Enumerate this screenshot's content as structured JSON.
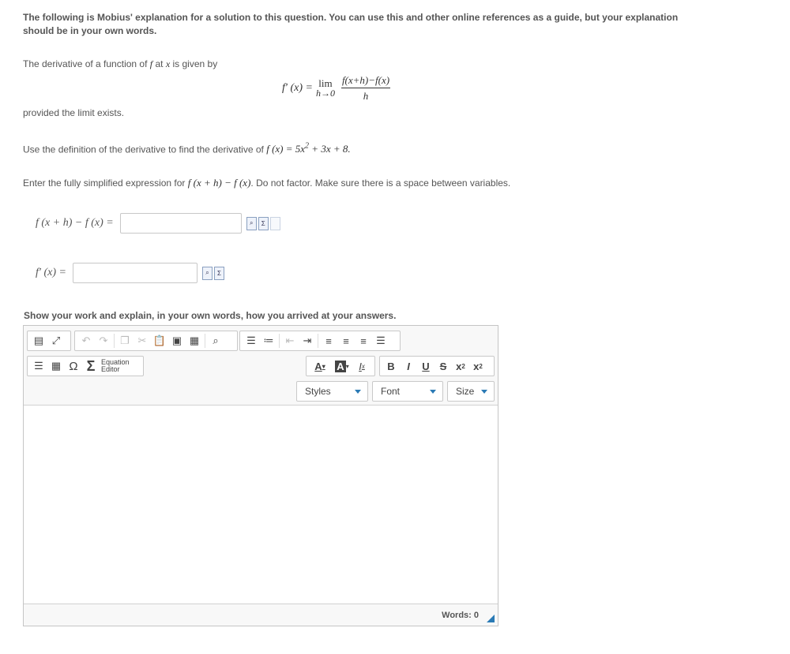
{
  "intro": "The following is Mobius' explanation for a solution to this question. You can use this and other online references as a guide, but your explanation should be in your own words.",
  "definition": {
    "text_a": "The derivative of a function of",
    "f": "f",
    "text_b": "at",
    "x": "x",
    "text_c": "is given by"
  },
  "formula": {
    "lhs": "f′ (x) =",
    "lim": "lim",
    "lim_sub": "h→0",
    "numerator": "f(x+h)−f(x)",
    "denominator": "h"
  },
  "limit_note": "provided the limit exists.",
  "task": {
    "text": "Use the definition of the derivative to find the derivative of",
    "func_lhs": "f (x) = 5x",
    "exp": "2",
    "func_rest": "+ 3x + 8."
  },
  "instruction": {
    "text_a": "Enter the fully simplified expression for",
    "expr": "f (x + h) − f (x)",
    "text_b": ". Do not factor. Make sure there is a space between variables."
  },
  "answers": [
    {
      "label": "f (x + h) − f (x) =",
      "value": ""
    },
    {
      "label": "f′ (x) =",
      "value": ""
    }
  ],
  "show_work": "Show your work and explain, in your own words, how you arrived at your answers.",
  "editor": {
    "icons": {
      "source": "source-icon",
      "maximize": "maximize-icon",
      "undo": "undo-icon",
      "redo": "redo-icon",
      "copy": "copy-icon",
      "cut": "cut-icon",
      "paste": "paste-icon",
      "paste_text": "paste-text-icon",
      "paste_word": "paste-word-icon",
      "find": "find-icon",
      "ordered_list": "ordered-list-icon",
      "bullet_list": "bullet-list-icon",
      "outdent": "outdent-icon",
      "indent": "indent-icon",
      "align_left": "align-left-icon",
      "align_center": "align-center-icon",
      "align_right": "align-right-icon",
      "justify": "justify-icon",
      "hr": "horizontal-rule-icon",
      "table": "table-icon",
      "special_char": "omega-icon",
      "equation": "sigma-icon"
    },
    "equation_editor_label_1": "Equation",
    "equation_editor_label_2": "Editor",
    "text_color_label": "A",
    "bg_color_label": "A",
    "remove_format_label": "I",
    "remove_format_sub": "x",
    "bold": "B",
    "italic": "I",
    "underline": "U",
    "strike": "S",
    "subscript_base": "x",
    "subscript": "2",
    "superscript_base": "x",
    "superscript": "2",
    "styles": "Styles",
    "font": "Font",
    "size": "Size",
    "words_label": "Words: 0"
  }
}
